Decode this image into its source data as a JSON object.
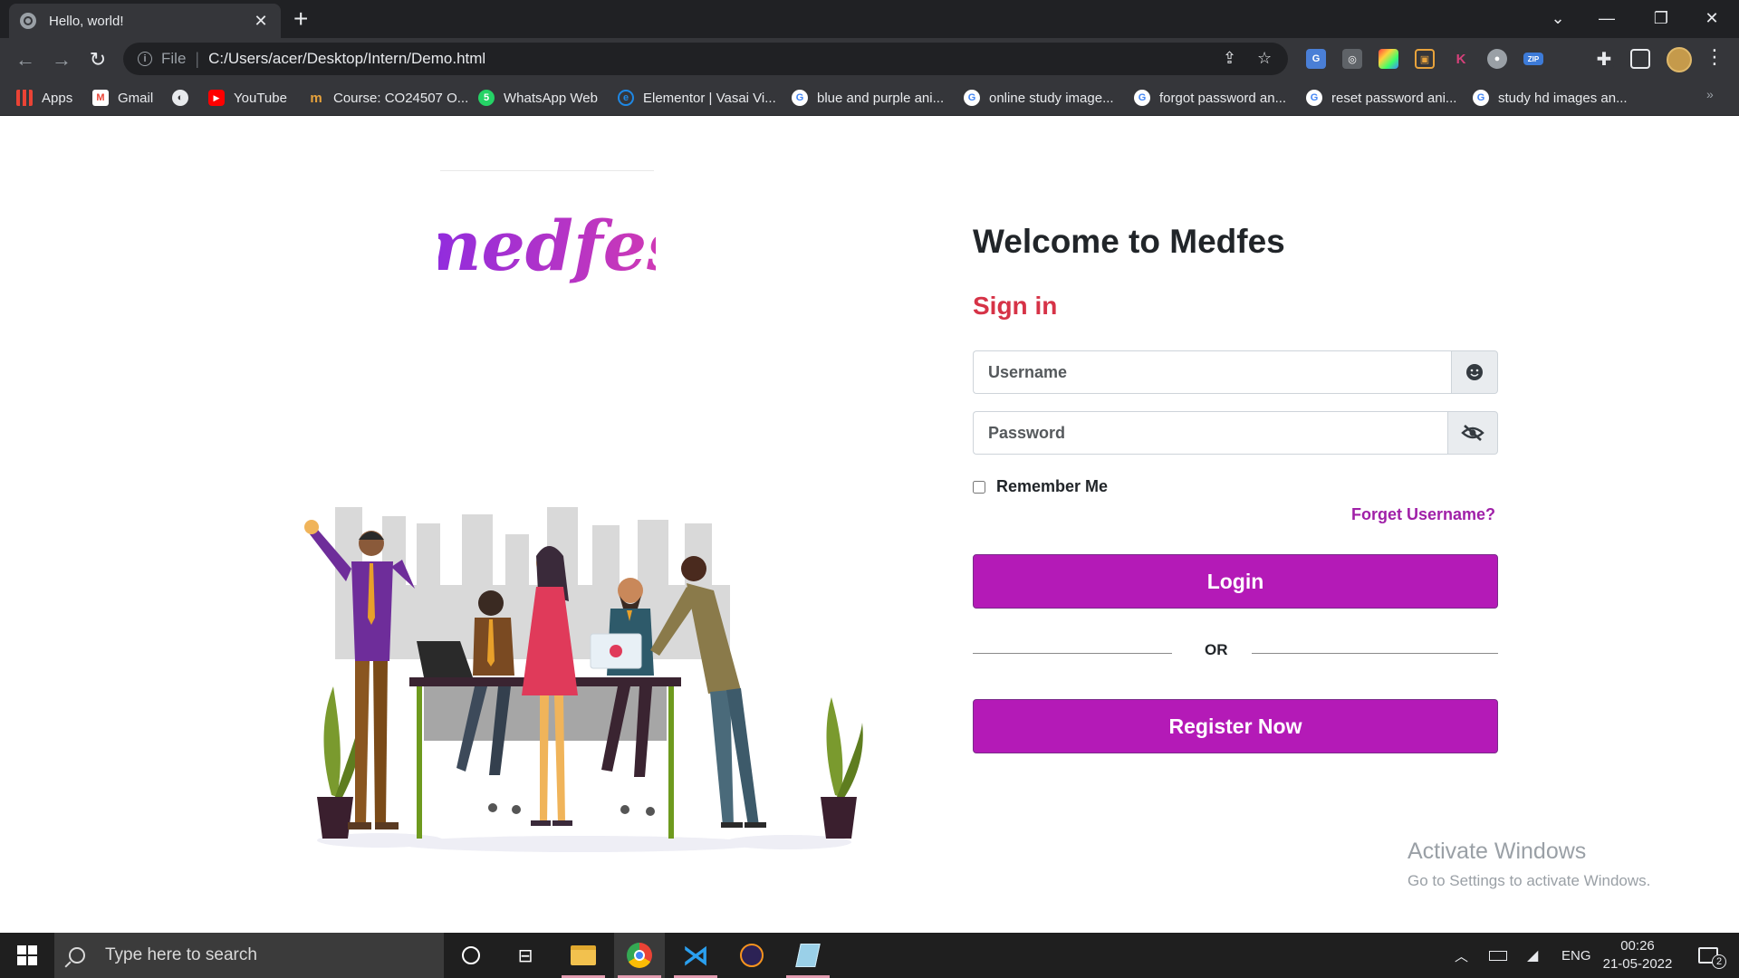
{
  "browser": {
    "tab_title": "Hello, world!",
    "tab_close": "✕",
    "new_tab": "+",
    "url_scheme": "File",
    "url": "C:/Users/acer/Desktop/Intern/Demo.html",
    "window_controls": {
      "dropdown": "⌄",
      "minimize": "—",
      "restore": "❐",
      "close": "✕"
    },
    "nav": {
      "back": "←",
      "forward": "→",
      "reload": "↻"
    },
    "extensions": [
      {
        "name": "translate",
        "label": "G",
        "color": "#4a7fd6"
      },
      {
        "name": "extension-2",
        "label": "◎",
        "color": "#5f6368"
      },
      {
        "name": "color-picker",
        "label": "✦",
        "color": "#e040a0"
      },
      {
        "name": "screen-capture",
        "label": "▣",
        "color": "#e8a33c"
      },
      {
        "name": "extension-k",
        "label": "K",
        "color": "#d6407a"
      },
      {
        "name": "extension-record",
        "label": "●",
        "color": "#5f6368"
      },
      {
        "name": "zip-extension",
        "label": "ZIP",
        "color": "#3d7bd8"
      }
    ]
  },
  "bookmarks": [
    {
      "label": "Apps",
      "icon": "apps-grid-icon",
      "color": "#e8453c"
    },
    {
      "label": "Gmail",
      "icon": "gmail-icon",
      "color": "#ea4335"
    },
    {
      "label": "",
      "icon": "globe-icon",
      "color": "#e8eaed"
    },
    {
      "label": "YouTube",
      "icon": "youtube-icon",
      "color": "#ff0000"
    },
    {
      "label": "Course: CO24507 O...",
      "icon": "course-icon",
      "color": "#e8a33c"
    },
    {
      "label": "WhatsApp Web",
      "icon": "whatsapp-icon",
      "color": "#25d366"
    },
    {
      "label": "Elementor | Vasai Vi...",
      "icon": "elementor-icon",
      "color": "#1e88e5"
    },
    {
      "label": "blue and purple ani...",
      "icon": "google-icon",
      "color": "#ffffff"
    },
    {
      "label": "online study image...",
      "icon": "google-icon",
      "color": "#ffffff"
    },
    {
      "label": "forgot password an...",
      "icon": "google-icon",
      "color": "#ffffff"
    },
    {
      "label": "reset password ani...",
      "icon": "google-icon",
      "color": "#ffffff"
    },
    {
      "label": "study hd images an...",
      "icon": "google-icon",
      "color": "#ffffff"
    }
  ],
  "bookmarks_more": "»",
  "page": {
    "logo_text": "medfes",
    "welcome": "Welcome to Medfes",
    "signin": "Sign in",
    "username_placeholder": "Username",
    "password_placeholder": "Password",
    "remember_label": "Remember Me",
    "forget_link": "Forget Username?",
    "login_button": "Login",
    "or_text": "OR",
    "register_button": "Register Now"
  },
  "watermark": {
    "line1": "Activate Windows",
    "line2": "Go to Settings to activate Windows."
  },
  "taskbar": {
    "search_placeholder": "Type here to search",
    "language": "ENG",
    "time": "00:26",
    "date": "21-05-2022",
    "notification_count": "2"
  }
}
